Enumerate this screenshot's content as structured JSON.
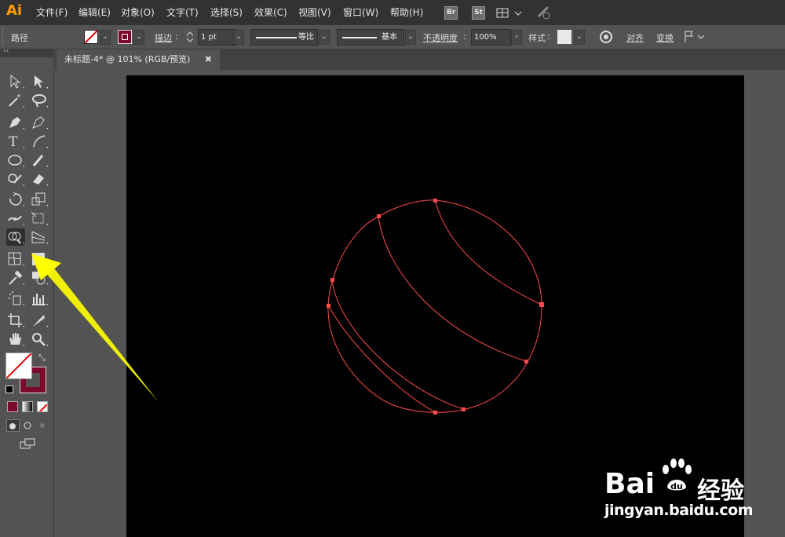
{
  "app": {
    "logo": "Ai"
  },
  "menu": [
    "文件(F)",
    "编辑(E)",
    "对象(O)",
    "文字(T)",
    "选择(S)",
    "效果(C)",
    "视图(V)",
    "窗口(W)",
    "帮助(H)"
  ],
  "menu_icons": {
    "br": "Br",
    "st": "St"
  },
  "control": {
    "object_type": "路径",
    "stroke_label": "描边",
    "stroke_weight": "1 pt",
    "profile_label": "等比",
    "brush_label": "基本",
    "opacity_label": "不透明度",
    "opacity_value": "100%",
    "style_label": "样式",
    "align_label": "对齐",
    "transform_label": "变换"
  },
  "document_tab": {
    "title": "未标题-4* @ 101% (RGB/预览)",
    "close": "✖"
  },
  "collapse": "‹‹",
  "colors": {
    "stroke": "#ff4a4a",
    "fill_swatch": "#7c0a2c",
    "arrow": "#ffff00",
    "artboard": "#000000"
  },
  "watermark": {
    "brand_left": "Bai",
    "brand_right": "经验",
    "url": "jingyan.baidu.com"
  }
}
